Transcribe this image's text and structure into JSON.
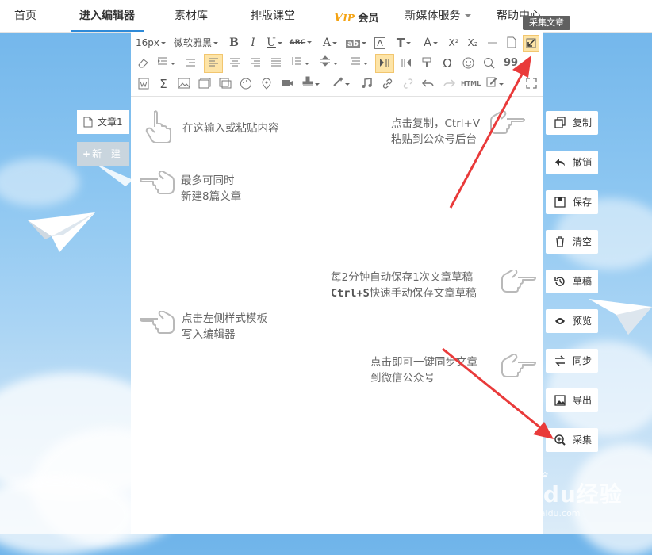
{
  "nav": {
    "items": [
      "首页",
      "进入编辑器",
      "素材库",
      "排版课堂",
      "新媒体服务",
      "帮助中心"
    ],
    "vip_v": "V",
    "vip_ip": "IP",
    "vip_label": "会员"
  },
  "toolbar": {
    "font_size": "16px",
    "font_family": "微软雅黑",
    "bold": "B",
    "italic": "I",
    "underline": "U",
    "strike": "ABC",
    "font_color": "A",
    "bg_color": "ab",
    "text_border": "A",
    "text_t": "T",
    "letter_a": "A",
    "superscript": "X²",
    "subscript": "X₂",
    "html": "HTML",
    "omega": "Ω",
    "quote": "99",
    "sigma": "Σ",
    "tooltip": "采集文章"
  },
  "hints": {
    "input": "在这输入或粘贴内容",
    "copy_line1": "点击复制，Ctrl+V",
    "copy_line2": "粘贴到公众号后台",
    "max_line1": "最多可同时",
    "max_line2": "新建8篇文章",
    "save_line1": "每2分钟自动保存1次文章草稿",
    "save_key": "Ctrl+S",
    "save_line2": "快速手动保存文章草稿",
    "tmpl_line1": "点击左侧样式模板",
    "tmpl_line2": "写入编辑器",
    "sync_line1": "点击即可一键同步文章",
    "sync_line2": "到微信公众号"
  },
  "left": {
    "doc_tab": "文章1",
    "new_button": "新 建"
  },
  "right_buttons": [
    "复制",
    "撤销",
    "保存",
    "清空",
    "草稿",
    "预览",
    "同步",
    "导出",
    "采集"
  ],
  "watermark": {
    "main": "Baidu经验",
    "sub": "jingyan.baidu.com"
  },
  "colors": {
    "accent": "#2e8ad8",
    "arrow": "#e93a3a",
    "vip": "#f4a313",
    "selected": "#fde4a7"
  }
}
